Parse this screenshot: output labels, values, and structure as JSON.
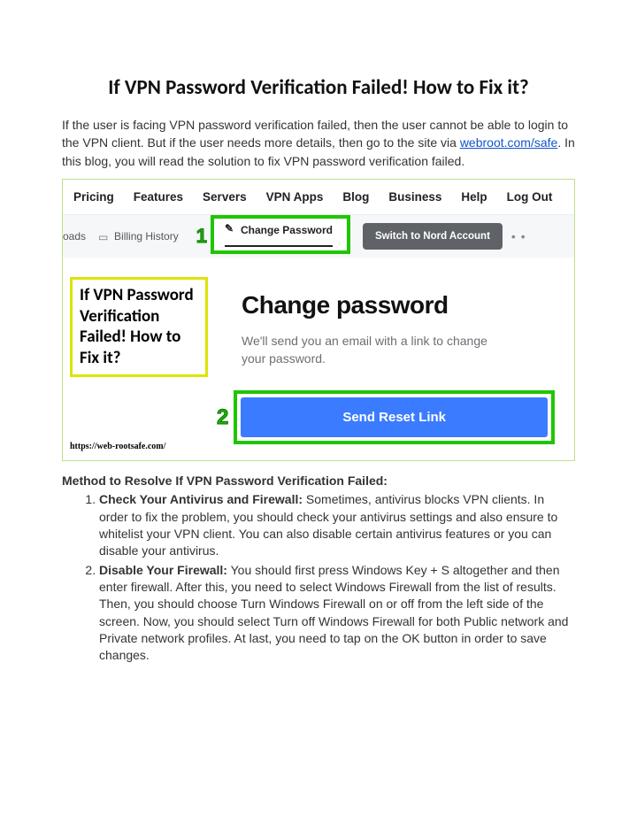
{
  "title": "If VPN Password Verification Failed! How to Fix it?",
  "intro_before_link": "If the user is facing VPN password verification failed, then the user cannot be able to login to the VPN client. But if the user needs more details, then go to the site via ",
  "intro_link_text": "webroot.com/safe",
  "intro_after_link": ". In this blog, you will read the solution to fix VPN password verification failed.",
  "figure": {
    "topnav": [
      "Pricing",
      "Features",
      "Servers",
      "VPN Apps",
      "Blog",
      "Business",
      "Help",
      "Log Out"
    ],
    "subbar": {
      "left_crumb": "oads",
      "billing": "Billing History",
      "step1": "1",
      "change_pw_tab": "Change Password",
      "switch_btn": "Switch to Nord Account",
      "dots": "•  •"
    },
    "callout": "If VPN Password Verification Failed! How to Fix it?",
    "site_url": "https://web-rootsafe.com/",
    "cp_heading": "Change password",
    "cp_sub": "We'll send you an email with a link to change your password.",
    "step2": "2",
    "send_btn": "Send Reset Link"
  },
  "method_heading": "Method to Resolve If VPN Password Verification Failed:",
  "steps": [
    {
      "label": "Check Your Antivirus and Firewall:",
      "body": " Sometimes, antivirus blocks VPN clients. In order to fix the problem, you should check your antivirus settings and also ensure to whitelist your VPN client. You can also disable certain antivirus features or you can disable your antivirus."
    },
    {
      "label": "Disable Your Firewall:",
      "body": " You should first press Windows Key + S altogether and then enter firewall. After this, you need to select Windows Firewall from the list of results. Then, you should choose Turn Windows Firewall on or off from the left side of the screen. Now, you should select Turn off Windows Firewall for both Public network and Private network profiles. At last, you need to tap on the OK button in order to save changes."
    }
  ]
}
